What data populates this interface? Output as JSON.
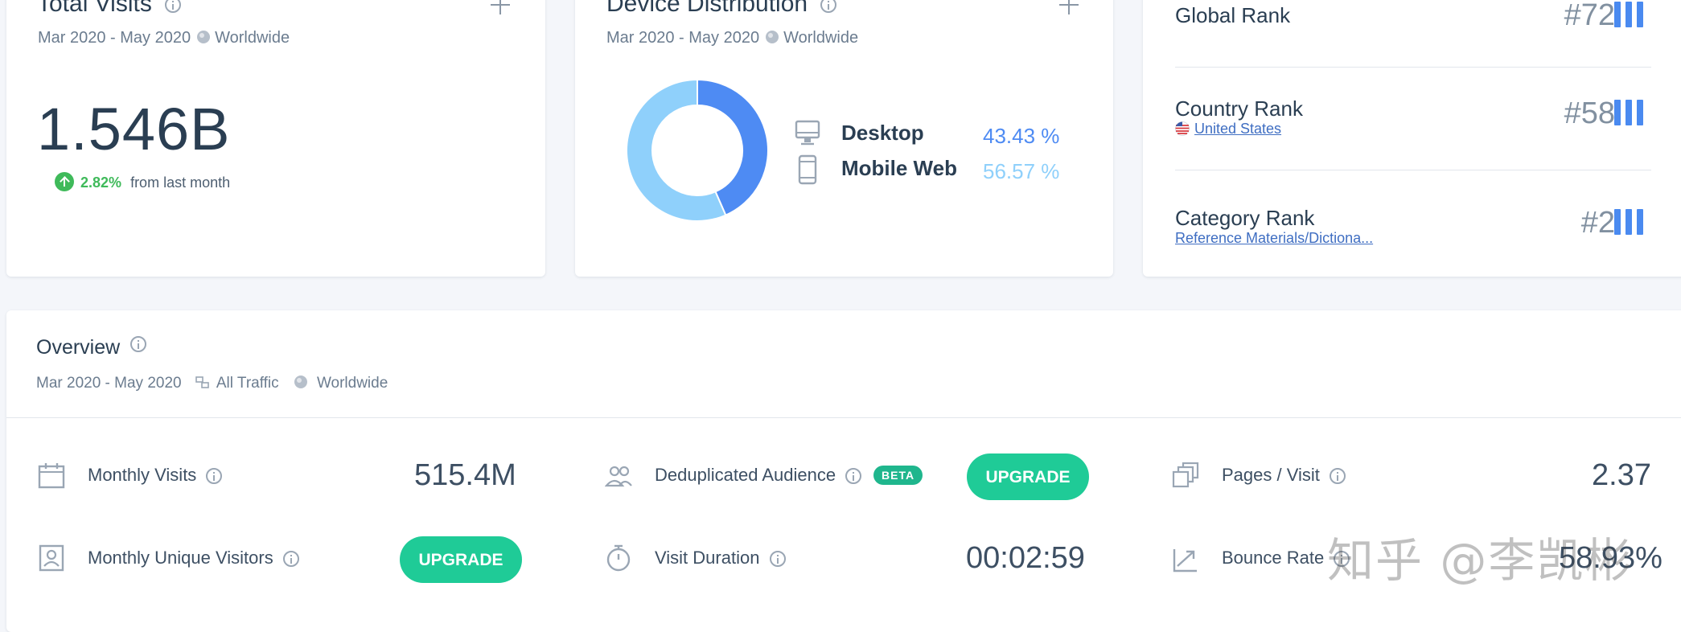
{
  "total_visits": {
    "title": "Total Visits",
    "date_range": "Mar 2020 - May 2020",
    "region": "Worldwide",
    "value": "1.546B",
    "change": "2.82%",
    "change_suffix": "from last month"
  },
  "device_distribution": {
    "title": "Device Distribution",
    "date_range": "Mar 2020 - May 2020",
    "region": "Worldwide",
    "items": [
      {
        "label": "Desktop",
        "value": "43.43 %",
        "color": "#4e8bf3"
      },
      {
        "label": "Mobile Web",
        "value": "56.57 %",
        "color": "#8fd0fb"
      }
    ]
  },
  "ranks": {
    "global": {
      "label": "Global Rank",
      "value": "#72"
    },
    "country": {
      "label": "Country Rank",
      "link": "United States",
      "value": "#58"
    },
    "category": {
      "label": "Category Rank",
      "link": "Reference Materials/Dictiona...",
      "value": "#2"
    }
  },
  "overview": {
    "title": "Overview",
    "date_range": "Mar 2020 - May 2020",
    "traffic": "All Traffic",
    "region": "Worldwide",
    "metrics": {
      "monthly_visits": {
        "label": "Monthly Visits",
        "value": "515.4M"
      },
      "dedup_audience": {
        "label": "Deduplicated Audience",
        "badge": "BETA",
        "button": "UPGRADE"
      },
      "pages_visit": {
        "label": "Pages / Visit",
        "value": "2.37"
      },
      "unique_visitors": {
        "label": "Monthly Unique Visitors",
        "button": "UPGRADE"
      },
      "visit_duration": {
        "label": "Visit Duration",
        "value": "00:02:59"
      },
      "bounce_rate": {
        "label": "Bounce Rate",
        "value": "58.93%"
      }
    }
  },
  "watermark": "知乎 @李凯彬",
  "colors": {
    "accent_blue": "#4a8af0",
    "upgrade_green": "#1fcb97",
    "positive_green": "#3fba5a"
  }
}
